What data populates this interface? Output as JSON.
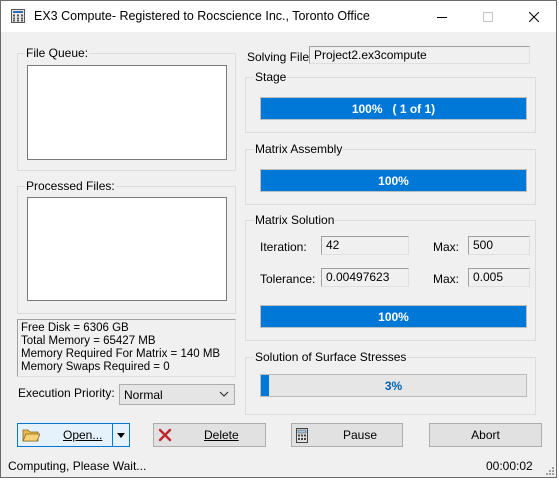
{
  "window": {
    "title": "EX3 Compute- Registered to Rocscience Inc., Toronto Office"
  },
  "left": {
    "file_queue_label": "File Queue:",
    "processed_files_label": "Processed Files:",
    "memory_info": [
      "Free Disk = 6306 GB",
      "Total Memory = 65427 MB",
      "Memory Required For Matrix = 140 MB",
      "Memory Swaps Required = 0"
    ],
    "execution_priority_label": "Execution Priority:",
    "execution_priority_value": "Normal"
  },
  "solving": {
    "label": "Solving File:",
    "value": "Project2.ex3compute"
  },
  "stage": {
    "label": "Stage",
    "progress": 1.0,
    "text": "100%   ( 1 of 1)"
  },
  "matrix_assembly": {
    "label": "Matrix Assembly",
    "progress": 1.0,
    "text": "100%"
  },
  "matrix_solution": {
    "label": "Matrix Solution",
    "iteration_label": "Iteration:",
    "iteration_value": "42",
    "max_label": "Max:",
    "iteration_max": "500",
    "tolerance_label": "Tolerance:",
    "tolerance_value": "0.00497623",
    "tolerance_max_label": "Max:",
    "tolerance_max": "0.005",
    "progress": 1.0,
    "text": "100%"
  },
  "surface_stresses": {
    "label": "Solution of Surface Stresses",
    "progress": 0.03,
    "text": "3%"
  },
  "buttons": {
    "open": "Open...",
    "delete": "Delete",
    "pause": "Pause",
    "abort": "Abort"
  },
  "status": {
    "message": "Computing, Please Wait...",
    "elapsed": "00:00:02"
  },
  "colors": {
    "progress_fill": "#0078d7",
    "background": "#f0f0f0"
  }
}
